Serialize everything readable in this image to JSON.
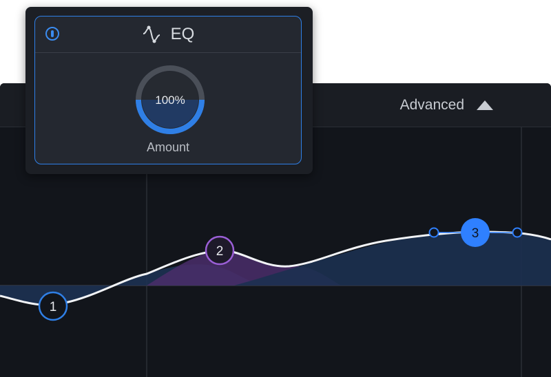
{
  "header": {
    "advanced_label": "Advanced"
  },
  "popup": {
    "title": "EQ",
    "amount_value": "100%",
    "amount_label": "Amount",
    "amount_level": 1.0,
    "power_on": true
  },
  "bands": [
    {
      "label": "1",
      "color": "#2f7fe6",
      "style": "outline"
    },
    {
      "label": "2",
      "color": "#9a5fd6",
      "style": "outline"
    },
    {
      "label": "3",
      "color": "#2f80ff",
      "style": "filled"
    }
  ],
  "colors": {
    "accent": "#2f80e8",
    "curve": "#ffffff",
    "background": "#12151b"
  }
}
